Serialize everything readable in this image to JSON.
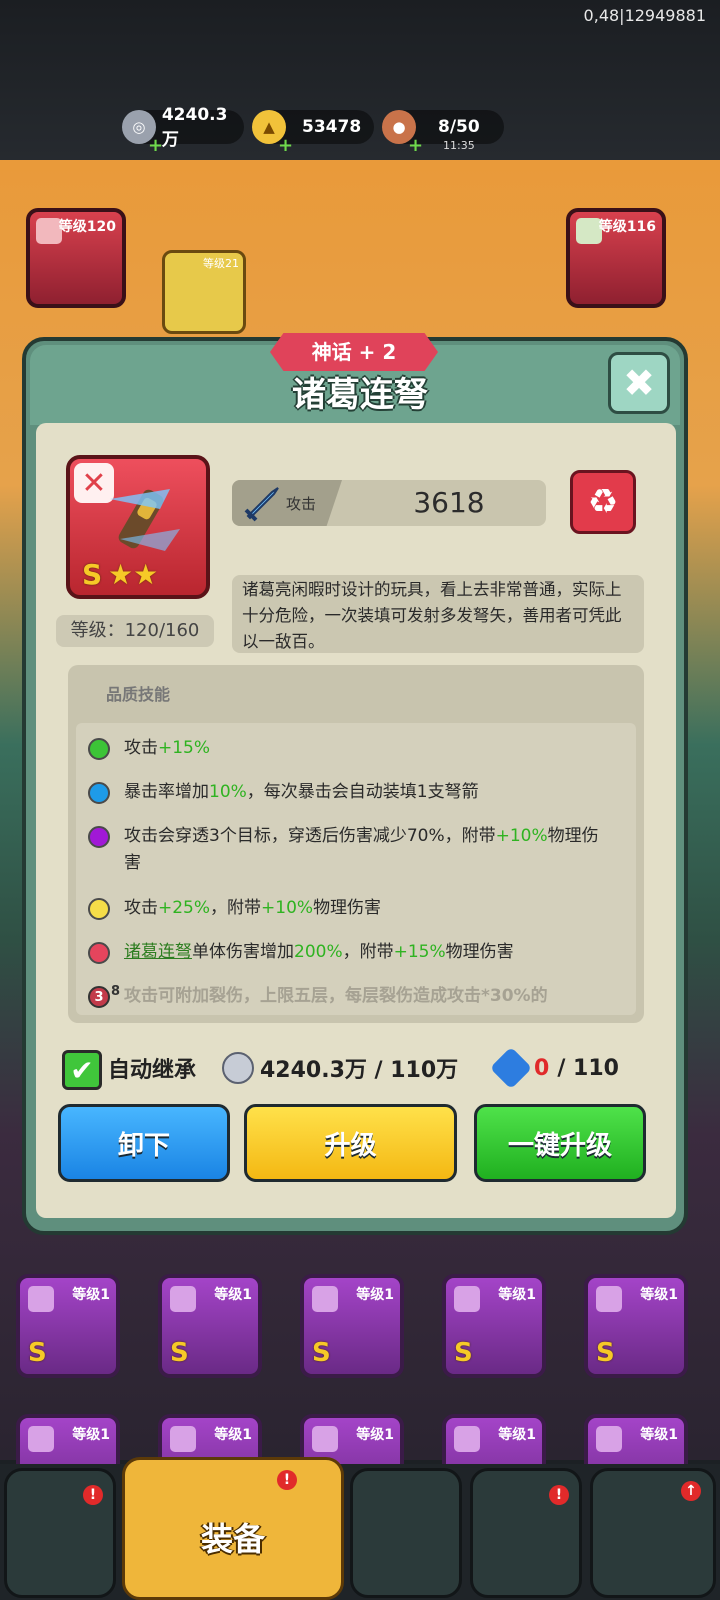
{
  "status": {
    "debug_text": "0,48|12949881"
  },
  "resources": {
    "silver": "4240.3万",
    "gold": "53478",
    "stamina": "8/50",
    "stamina_timer": "11:35"
  },
  "equipped_slots": {
    "left_level": "等级120",
    "small_level": "等级21",
    "right_level": "等级116"
  },
  "dialog": {
    "rarity_label": "神话 + 2",
    "title": "诸葛连弩",
    "item_grade": "S",
    "level_text": "等级：120/160",
    "attack_label": "攻击",
    "attack_value": "3618",
    "description": "诸葛亮闲暇时设计的玩具，看上去非常普通，实际上十分危险，一次装填可发射多发弩矢，善用者可凭此以一敌百。",
    "skills_header": "品质技能",
    "skills": [
      {
        "color": "#3cc437",
        "parts": [
          "攻击",
          "+15%"
        ]
      },
      {
        "color": "#1e9be8",
        "parts": [
          "暴击率增加",
          "10%",
          "，每次暴击会自动装填1支弩箭"
        ]
      },
      {
        "color": "#a118d6",
        "parts": [
          "攻击会穿透3个目标，穿透后伤害减少70%，附带",
          "+10%",
          "物理伤害"
        ]
      },
      {
        "color": "#f5dd49",
        "parts": [
          "攻击",
          "+25%",
          "，附带",
          "+10%",
          "物理伤害"
        ]
      },
      {
        "color": "#e5455d",
        "parts": [
          "诸葛连弩",
          "单体伤害增加",
          "200%",
          "，附带",
          "+15%",
          "物理伤害"
        ]
      },
      {
        "badge": "3",
        "sup": "8",
        "parts": [
          "攻击可附加裂伤，上限五层，每层裂伤造成攻击*30%的"
        ]
      }
    ],
    "auto_inherit_label": "自动继承",
    "silver_cost": "4240.3万 / 110万",
    "gem_owned": "0",
    "gem_cost": "/ 110",
    "buttons": {
      "unequip": "卸下",
      "upgrade": "升级",
      "one_click_upgrade": "一键升级"
    }
  },
  "inventory": {
    "row1_levels": [
      "等级1",
      "等级1",
      "等级1",
      "等级1",
      "等级1"
    ],
    "row2_levels": [
      "等级1",
      "等级1",
      "等级1",
      "等级1",
      "等级1"
    ]
  },
  "nav": {
    "active_label": "装备"
  },
  "colors": {
    "accent_red": "#e0435a",
    "panel_green": "#5f8f7d",
    "btn_blue": "#1a84e4",
    "btn_yellow": "#f4b813",
    "btn_green": "#20b020"
  }
}
